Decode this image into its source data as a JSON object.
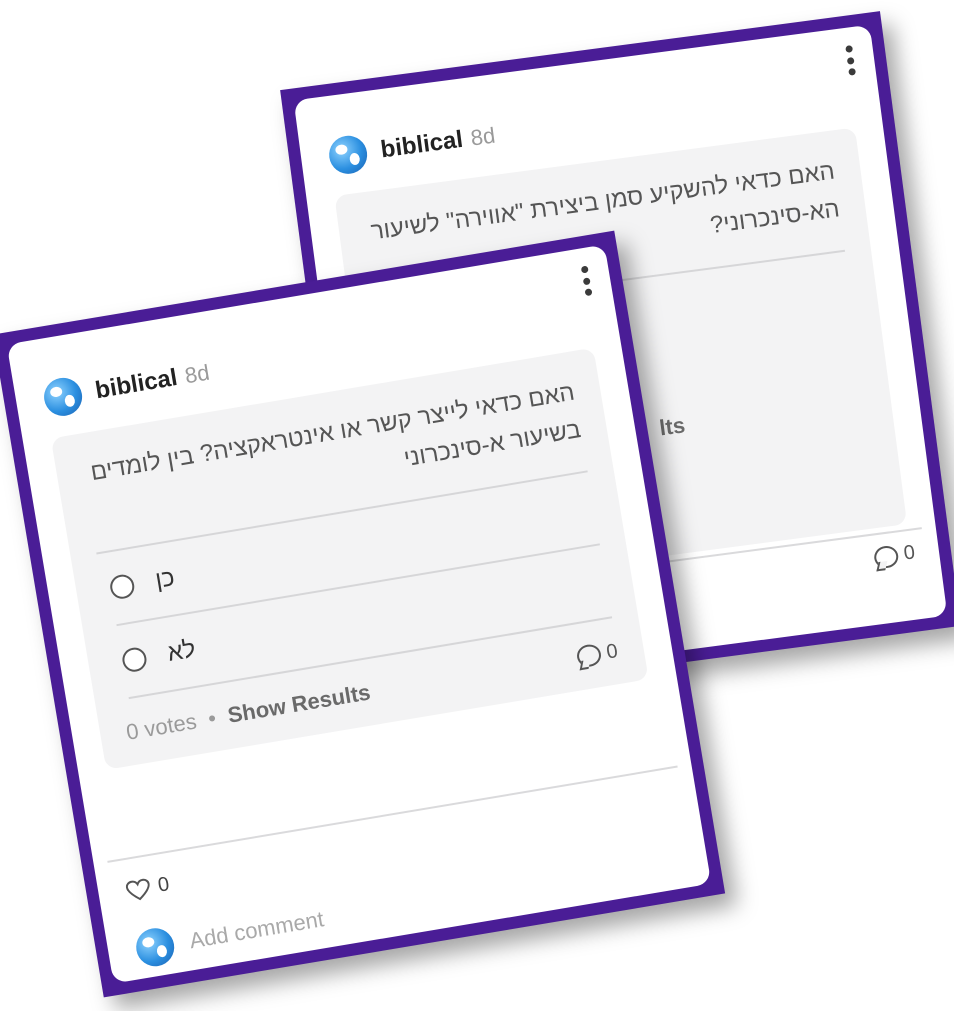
{
  "back_card": {
    "author": "biblical",
    "age": "8d",
    "question": "האם כדאי להשקיע סמן ביצירת \"אווירה\" לשיעור הא-סינכרוני?",
    "show_results_partial": "lts",
    "comment_count": "0"
  },
  "front_card": {
    "author": "biblical",
    "age": "8d",
    "question": "האם כדאי לייצר קשר או אינטראקציה? בין לומדים בשיעור א-סינכרוני",
    "options": [
      {
        "label": "כן"
      },
      {
        "label": "לא"
      }
    ],
    "votes": "0 votes",
    "separator": "•",
    "show_results": "Show Results",
    "comment_count": "0",
    "like_count": "0",
    "add_comment_placeholder": "Add comment"
  },
  "colors": {
    "frame": "#4a1d96",
    "poll_bg": "#f3f3f4"
  }
}
